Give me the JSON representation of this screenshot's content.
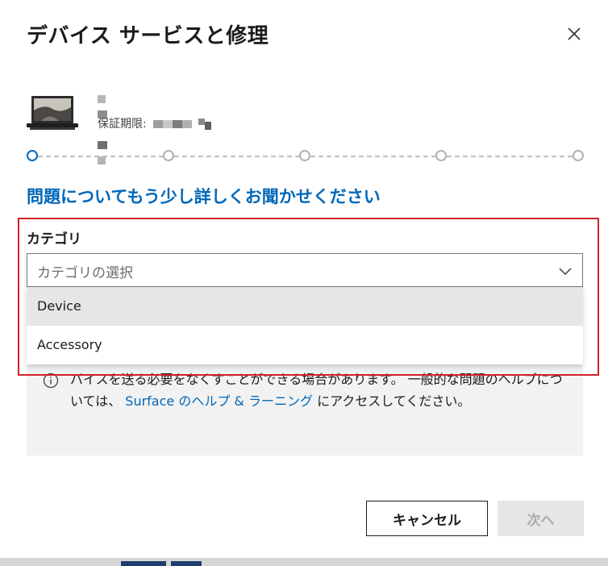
{
  "dialog": {
    "title": "デバイス サービスと修理",
    "close_icon": "close-icon"
  },
  "device": {
    "image_icon": "laptop-icon",
    "warranty_label": "保証期限:"
  },
  "stepper": {
    "total_steps": 5,
    "current_step": 1
  },
  "form": {
    "heading": "問題についてもう少し詳しくお聞かせください",
    "category_label": "カテゴリ",
    "category_placeholder": "カテゴリの選択",
    "options": [
      "Device",
      "Accessory"
    ]
  },
  "info": {
    "icon": "info-icon",
    "text_before": "バイスを送る必要をなくすことができる場合があります。 一般的な問題のヘルプについては、",
    "link": "Surface のヘルプ & ラーニング",
    "text_after": "にアクセスしてください。"
  },
  "footer": {
    "cancel_label": "キャンセル",
    "next_label": "次へ"
  },
  "colors": {
    "accent": "#0067b8",
    "highlight_border": "#d1222a"
  }
}
